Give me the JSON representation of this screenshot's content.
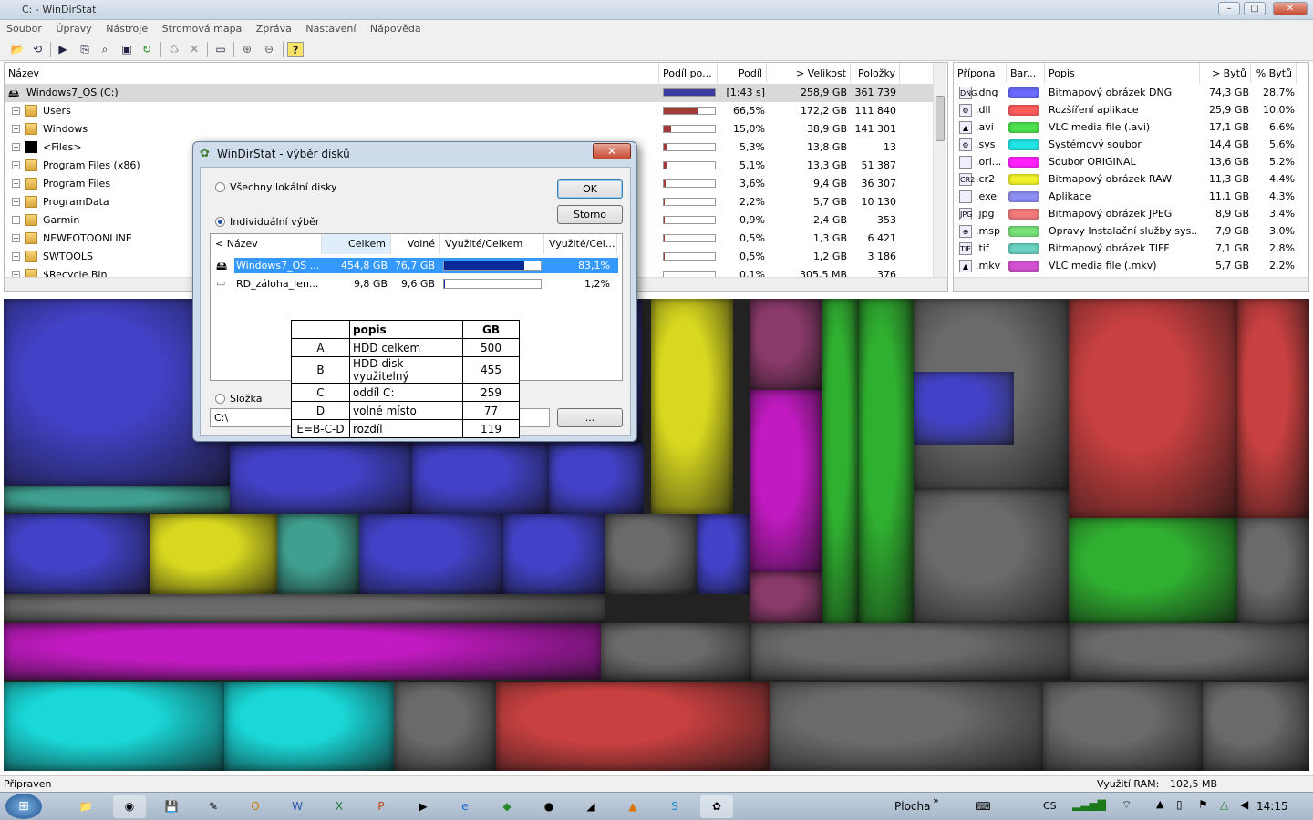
{
  "window": {
    "title": "C: - WinDirStat"
  },
  "menu": [
    "Soubor",
    "Úpravy",
    "Nástroje",
    "Stromová mapa",
    "Zpráva",
    "Nastavení",
    "Nápověda"
  ],
  "tree": {
    "headers": {
      "name": "Název",
      "subtree": "Podíl po...",
      "percent": "Podíl",
      "size": "> Velikost",
      "items": "Položky"
    },
    "rows": [
      {
        "name": "Windows7_OS (C:)",
        "share": "[1:43 s]",
        "size": "258,9 GB",
        "items": "361 739",
        "fill": 1.0,
        "color": "#3c3ca0"
      },
      {
        "name": "Users",
        "share": "66,5%",
        "size": "172,2 GB",
        "items": "111 840",
        "fill": 0.665,
        "color": "#a33a3a"
      },
      {
        "name": "Windows",
        "share": "15,0%",
        "size": "38,9 GB",
        "items": "141 301",
        "fill": 0.15,
        "color": "#a33a3a"
      },
      {
        "name": "<Files>",
        "share": "5,3%",
        "size": "13,8 GB",
        "items": "13",
        "fill": 0.053,
        "color": "#a33a3a"
      },
      {
        "name": "Program Files (x86)",
        "share": "5,1%",
        "size": "13,3 GB",
        "items": "51 387",
        "fill": 0.051,
        "color": "#a33a3a"
      },
      {
        "name": "Program Files",
        "share": "3,6%",
        "size": "9,4 GB",
        "items": "36 307",
        "fill": 0.036,
        "color": "#a33a3a"
      },
      {
        "name": "ProgramData",
        "share": "2,2%",
        "size": "5,7 GB",
        "items": "10 130",
        "fill": 0.022,
        "color": "#a33a3a"
      },
      {
        "name": "Garmin",
        "share": "0,9%",
        "size": "2,4 GB",
        "items": "353",
        "fill": 0.009,
        "color": "#a33a3a"
      },
      {
        "name": "NEWFOTOONLINE",
        "share": "0,5%",
        "size": "1,3 GB",
        "items": "6 421",
        "fill": 0.005,
        "color": "#a33a3a"
      },
      {
        "name": "SWTOOLS",
        "share": "0,5%",
        "size": "1,2 GB",
        "items": "3 186",
        "fill": 0.005,
        "color": "#a33a3a"
      },
      {
        "name": "$Recycle.Bin",
        "share": "0,1%",
        "size": "305,5 MB",
        "items": "376",
        "fill": 0.001,
        "color": "#a33a3a"
      }
    ]
  },
  "ext": {
    "headers": {
      "ext": "Přípona",
      "color": "Bar...",
      "desc": "Popis",
      "bytes": "> Bytů",
      "pct": "% Bytů"
    },
    "rows": [
      {
        "icon": "DNG",
        "ext": ".dng",
        "color": "#6b6bff",
        "desc": "Bitmapový obrázek DNG",
        "bytes": "74,3 GB",
        "pct": "28,7%"
      },
      {
        "icon": "⚙",
        "ext": ".dll",
        "color": "#ff5c5c",
        "desc": "Rozšíření aplikace",
        "bytes": "25,9 GB",
        "pct": "10,0%"
      },
      {
        "icon": "▲",
        "ext": ".avi",
        "color": "#4ee24e",
        "desc": "VLC media file (.avi)",
        "bytes": "17,1 GB",
        "pct": "6,6%"
      },
      {
        "icon": "⚙",
        "ext": ".sys",
        "color": "#22e6e6",
        "desc": "Systémový soubor",
        "bytes": "14,4 GB",
        "pct": "5,6%"
      },
      {
        "icon": "",
        "ext": ".ori...",
        "color": "#ff22ff",
        "desc": "Soubor ORIGINAL",
        "bytes": "13,6 GB",
        "pct": "5,2%"
      },
      {
        "icon": "CR2",
        "ext": ".cr2",
        "color": "#f2f22a",
        "desc": "Bitmapový obrázek RAW",
        "bytes": "11,3 GB",
        "pct": "4,4%"
      },
      {
        "icon": "",
        "ext": ".exe",
        "color": "#8f8ff2",
        "desc": "Aplikace",
        "bytes": "11,1 GB",
        "pct": "4,3%"
      },
      {
        "icon": "JPG",
        "ext": ".jpg",
        "color": "#f27a7a",
        "desc": "Bitmapový obrázek JPEG",
        "bytes": "8,9 GB",
        "pct": "3,4%"
      },
      {
        "icon": "⊕",
        "ext": ".msp",
        "color": "#7ae27a",
        "desc": "Opravy Instalační služby sys...",
        "bytes": "7,9 GB",
        "pct": "3,0%"
      },
      {
        "icon": "TIF",
        "ext": ".tif",
        "color": "#6ad2c2",
        "desc": "Bitmapový obrázek TIFF",
        "bytes": "7,1 GB",
        "pct": "2,8%"
      },
      {
        "icon": "▲",
        "ext": ".mkv",
        "color": "#d252d2",
        "desc": "VLC media file (.mkv)",
        "bytes": "5,7 GB",
        "pct": "2,2%"
      }
    ]
  },
  "dialog": {
    "title": "WinDirStat - výběr disků",
    "radio_all": "Všechny lokální disky",
    "radio_individual": "Individuální výběr",
    "radio_folder": "Složka",
    "ok": "OK",
    "cancel": "Storno",
    "browse": "...",
    "folder_value": "C:\\",
    "columns": {
      "name": "< Název",
      "total": "Celkem",
      "free": "Volné",
      "used_bar": "Využité/Celkem",
      "used_pct": "Využité/Cel..."
    },
    "disks": [
      {
        "name": "Windows7_OS ...",
        "total": "454,8 GB",
        "free": "76,7 GB",
        "used": 0.831,
        "pct": "83,1%"
      },
      {
        "name": "RD_záloha_len...",
        "total": "9,8 GB",
        "free": "9,6 GB",
        "used": 0.012,
        "pct": "1,2%"
      }
    ]
  },
  "annotation": {
    "headers": [
      "",
      "popis",
      "GB"
    ],
    "rows": [
      [
        "A",
        "HDD celkem",
        "500"
      ],
      [
        "B",
        "HDD disk využitelný",
        "455"
      ],
      [
        "C",
        "oddíl C:",
        "259"
      ],
      [
        "D",
        "volné místo",
        "77"
      ],
      [
        "E=B-C-D",
        "rozdíl",
        "119"
      ]
    ]
  },
  "status": {
    "left": "Připraven",
    "ram_label": "Využití RAM:",
    "ram_value": "102,5 MB"
  },
  "taskbar": {
    "desktop": "Plocha",
    "lang": "CS",
    "time": "14:15"
  }
}
